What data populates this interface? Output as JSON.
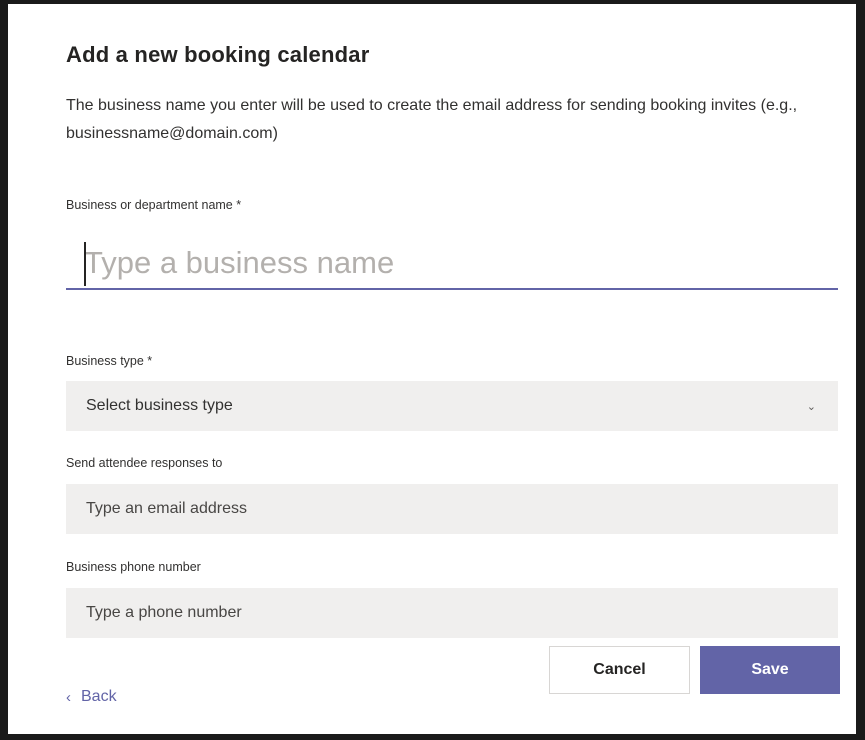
{
  "dialog": {
    "title": "Add a new booking calendar",
    "description": "The business name you enter will be used to create the email address for sending booking invites (e.g., businessname@domain.com)"
  },
  "business_name": {
    "label": "Business or department name *",
    "placeholder": "Type a business name",
    "value": ""
  },
  "business_type": {
    "label": "Business type *",
    "selected": "Select business type",
    "chevron_icon": "chevron-down-icon"
  },
  "attendee_responses": {
    "label": "Send attendee responses to",
    "placeholder": "Type an email address"
  },
  "phone": {
    "label": "Business phone number",
    "placeholder": "Type a phone number"
  },
  "footer": {
    "back_label": "Back",
    "back_icon": "chevron-left-icon",
    "cancel_label": "Cancel",
    "save_label": "Save"
  },
  "colors": {
    "accent": "#6264a7",
    "field_bg": "#f0efee"
  }
}
